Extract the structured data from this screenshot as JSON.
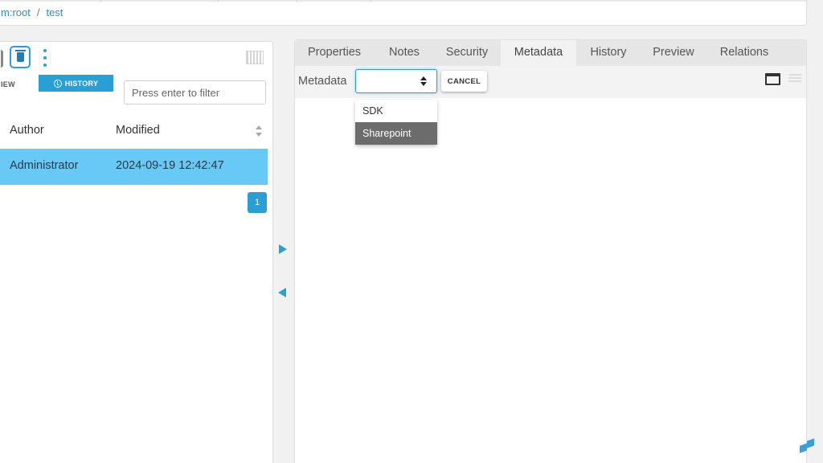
{
  "breadcrumb": {
    "root": "m:root",
    "separator": "/",
    "current": "test"
  },
  "left_panel": {
    "tabs": {
      "view": "IEW",
      "history": "HISTORY"
    },
    "filter": {
      "placeholder": "Press enter to filter",
      "value": ""
    },
    "columns": [
      "Author",
      "Modified"
    ],
    "rows": [
      {
        "author": "Administrator",
        "modified": "2024-09-19 12:42:47",
        "selected": true
      }
    ],
    "pagination": {
      "current_page": "1"
    }
  },
  "right_panel": {
    "tabs": [
      "Properties",
      "Notes",
      "Security",
      "Metadata",
      "History",
      "Preview",
      "Relations"
    ],
    "active_tab": "Metadata",
    "metadata": {
      "label": "Metadata",
      "select_value": "",
      "cancel_label": "CANCEL",
      "options": [
        "SDK",
        "Sharepoint"
      ],
      "highlighted_option": "Sharepoint"
    }
  },
  "colors": {
    "accent": "#2a9fd6",
    "selected_row": "#68c8f6",
    "highlighted_option": "#6c6c6c"
  },
  "icons": [
    "delete-icon",
    "more-vert-icon",
    "columns-icon",
    "history-icon",
    "sort-icon",
    "expand-right-icon",
    "collapse-left-icon",
    "window-icon",
    "list-icon",
    "brand-logo-icon"
  ]
}
